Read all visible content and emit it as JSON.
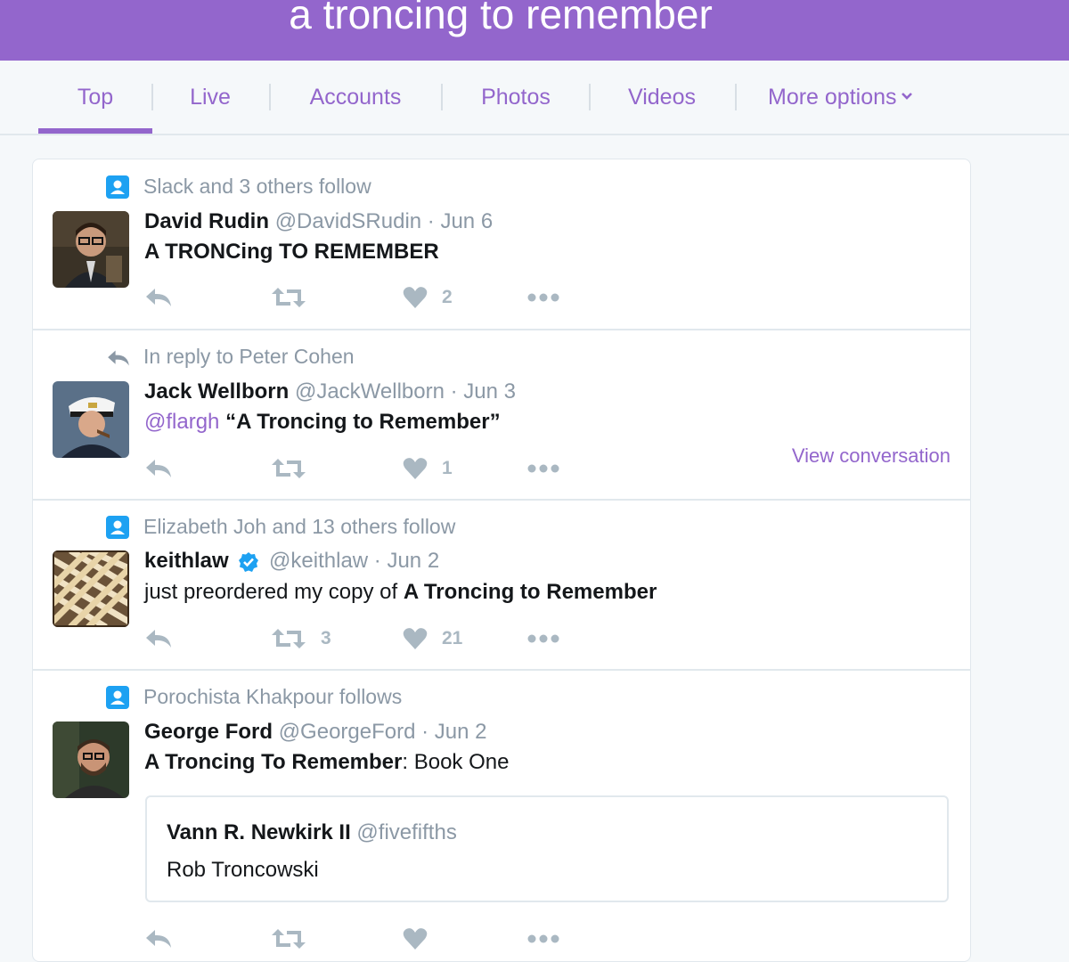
{
  "header": {
    "title": "a troncing to remember"
  },
  "tabs": [
    {
      "label": "Top"
    },
    {
      "label": "Live"
    },
    {
      "label": "Accounts"
    },
    {
      "label": "Photos"
    },
    {
      "label": "Videos"
    },
    {
      "label": "More options"
    }
  ],
  "colors": {
    "accent": "#9366cc",
    "muted": "#8b98a5",
    "icon": "#aab8c2",
    "verified": "#1da1f2"
  },
  "tweets": [
    {
      "context": "Slack and 3 others follow",
      "context_icon": "person-icon",
      "name": "David Rudin",
      "handle": "@DavidSRudin",
      "date": "· Jun 6",
      "text_bold": "A TRONCing TO REMEMBER",
      "likes": "2"
    },
    {
      "context": "In reply to Peter Cohen",
      "context_icon": "reply-icon",
      "name": "Jack Wellborn",
      "handle": "@JackWellborn",
      "date": "· Jun 3",
      "mention": "@flargh",
      "text_bold": "“A Troncing to Remember”",
      "likes": "1",
      "view_conversation": "View conversation"
    },
    {
      "context": "Elizabeth Joh and 13 others follow",
      "context_icon": "person-icon",
      "name": "keithlaw",
      "handle": "@keithlaw",
      "date": "· Jun 2",
      "text_plain": "just preordered my copy of",
      "text_bold": "A Troncing to Remember",
      "retweets": "3",
      "likes": "21"
    },
    {
      "context": "Porochista Khakpour follows",
      "context_icon": "person-icon",
      "name": "George Ford",
      "handle": "@GeorgeFord",
      "date": "· Jun 2",
      "text_bold": "A Troncing To Remember",
      "text_plain": ": Book One",
      "quote": {
        "name": "Vann R. Newkirk II",
        "handle": "@fivefifths",
        "text": "Rob Troncowski"
      }
    }
  ]
}
